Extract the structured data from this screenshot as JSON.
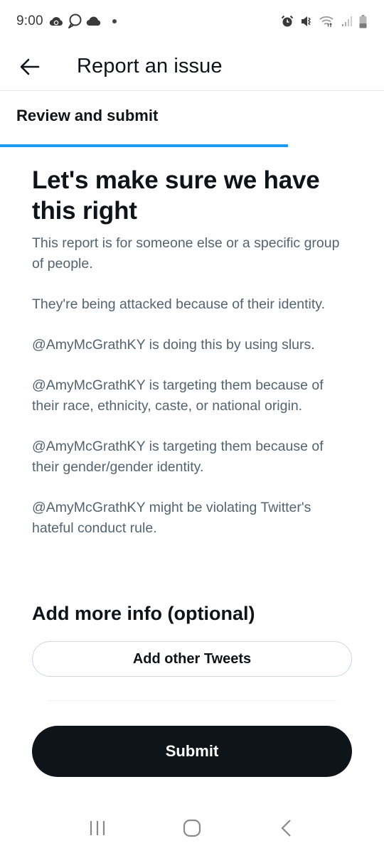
{
  "status_bar": {
    "time": "9:00",
    "left_icons": [
      "cloud-sync-icon",
      "chat-bubble-icon",
      "cloud-icon",
      "dot-icon"
    ],
    "right_icons": [
      "alarm-icon",
      "mute-icon",
      "wifi-icon",
      "signal-icon",
      "battery-icon"
    ]
  },
  "header": {
    "back_icon": "arrow-left-icon",
    "title": "Report an issue"
  },
  "step": {
    "label": "Review and submit",
    "progress": 0.75,
    "accent_color": "#1d9bf0"
  },
  "main": {
    "title": "Let's make sure we have this right",
    "summary": [
      "This report is for someone else or a specific group of people.",
      "They're being attacked because of their identity.",
      "@AmyMcGrathKY is doing this by using slurs.",
      "@AmyMcGrathKY is targeting them because of their race, ethnicity, caste, or national origin.",
      "@AmyMcGrathKY is targeting them because of their gender/gender identity.",
      "@AmyMcGrathKY might be violating Twitter's hateful conduct rule."
    ]
  },
  "more_info": {
    "title": "Add more info (optional)",
    "add_tweets_label": "Add other Tweets"
  },
  "actions": {
    "submit_label": "Submit"
  },
  "nav_bar": {
    "recents_icon": "recent-apps-icon",
    "home_icon": "home-icon",
    "back_icon": "back-chevron-icon"
  }
}
